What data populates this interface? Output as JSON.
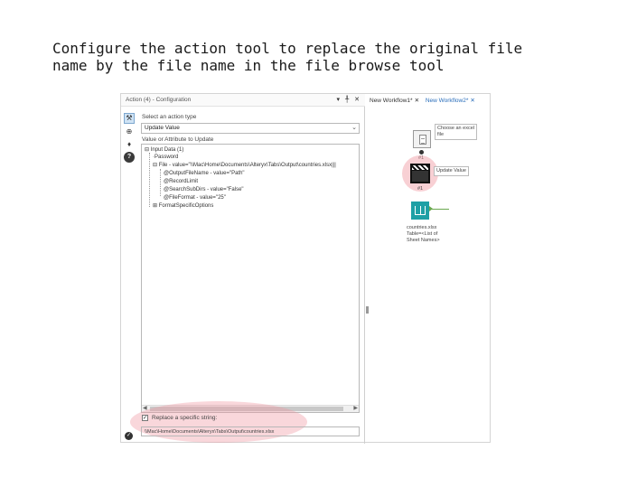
{
  "instruction": {
    "text": "Configure the action tool to replace the original file\nname by the file name in the file browse tool"
  },
  "config_panel": {
    "title": "Action (4) - Configuration",
    "title_controls": "▾ ╀ ✕",
    "toolbar_icons": [
      "wrench-icon",
      "connection-icon",
      "tag-icon",
      "help-icon"
    ],
    "select_action_label": "Select an action type",
    "action_type_value": "Update Value",
    "value_attr_label": "Value or Attribute to Update",
    "tree": [
      {
        "text": "Input Data (1)",
        "prefix": "⊟"
      },
      {
        "text": "Password",
        "prefix": "·"
      },
      {
        "text": "File - value=\"\\\\Mac\\Home\\Documents\\Alteryx\\Tabs\\Output\\countries.xlsx|||",
        "prefix": "⊟"
      },
      {
        "text": "@OutputFileName - value=\"Path\"",
        "prefix": ""
      },
      {
        "text": "@RecordLimit",
        "prefix": ""
      },
      {
        "text": "@SearchSubDirs - value=\"False\"",
        "prefix": ""
      },
      {
        "text": "@FileFormat - value=\"25\"",
        "prefix": ""
      },
      {
        "text": "FormatSpecificOptions",
        "prefix": "⊞"
      }
    ],
    "replace_checkbox_mark": "✓",
    "replace_label": "Replace a specific string:",
    "replace_value": "\\\\Mac\\Home\\Documents\\Alteryx\\Tabs\\Output\\countries.xlsx"
  },
  "canvas": {
    "tabs": [
      {
        "label": "New Workflow1*",
        "close": "✕",
        "active": false
      },
      {
        "label": "New Workflow2*",
        "close": "✕",
        "active": true
      }
    ],
    "input_annotation": "Choose an excel\nfile",
    "input_tool_label": "#1",
    "action_annotation": "Update Value",
    "action_tool_label": "#1",
    "output_annotation": "countries.xlsx\nTable=<List of\nSheet Names>"
  },
  "colors": {
    "highlight": "#f096a0",
    "output_tool": "#1ea0a5",
    "active_tab": "#2a6ebb",
    "output_arrow": "#6aa84f"
  }
}
